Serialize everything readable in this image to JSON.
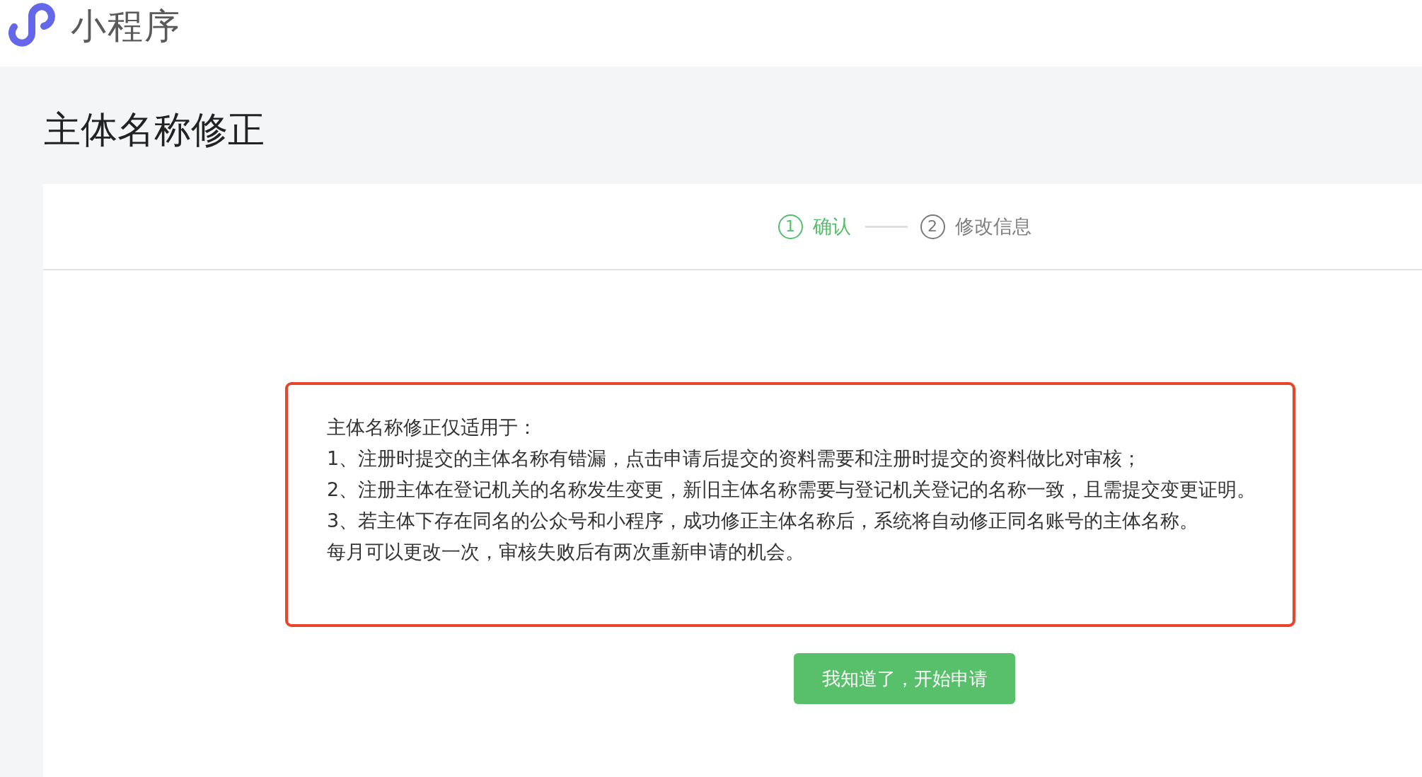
{
  "header": {
    "title": "小程序"
  },
  "page": {
    "title": "主体名称修正"
  },
  "steps": [
    {
      "number": "1",
      "label": "确认",
      "active": true
    },
    {
      "number": "2",
      "label": "修改信息",
      "active": false
    }
  ],
  "notice": {
    "lines": [
      "主体名称修正仅适用于：",
      "1、注册时提交的主体名称有错漏，点击申请后提交的资料需要和注册时提交的资料做比对审核；",
      "2、注册主体在登记机关的名称发生变更，新旧主体名称需要与登记机关登记的名称一致，且需提交变更证明。",
      "3、若主体下存在同名的公众号和小程序，成功修正主体名称后，系统将自动修正同名账号的主体名称。",
      "每月可以更改一次，审核失败后有两次重新申请的机会。"
    ]
  },
  "confirm_button": {
    "label": "我知道了，开始申请"
  }
}
